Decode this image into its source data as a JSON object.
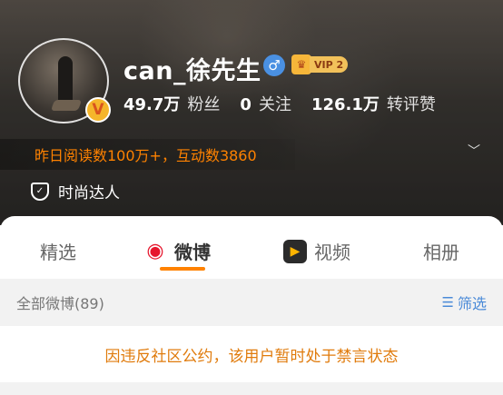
{
  "profile": {
    "name": "can_徐先生",
    "gender_icon": "male-icon",
    "vip_label": "VIP 2",
    "verified_badge": "V",
    "stats": [
      {
        "value": "49.7万",
        "label": "粉丝"
      },
      {
        "value": "0",
        "label": "关注"
      },
      {
        "value": "126.1万",
        "label": "转评赞"
      }
    ],
    "read_summary": "昨日阅读数100万+，互动数3860",
    "tag": "时尚达人"
  },
  "tabs": [
    {
      "label": "精选",
      "icon": ""
    },
    {
      "label": "微博",
      "icon": "weibo-icon"
    },
    {
      "label": "视频",
      "icon": "video-icon"
    },
    {
      "label": "相册",
      "icon": ""
    }
  ],
  "feed": {
    "count_label": "全部微博(89)",
    "filter_label": "筛选",
    "notice": "因违反社区公约，该用户暂时处于禁言状态"
  },
  "colors": {
    "accent": "#ff8200",
    "link": "#4a8ad8"
  }
}
